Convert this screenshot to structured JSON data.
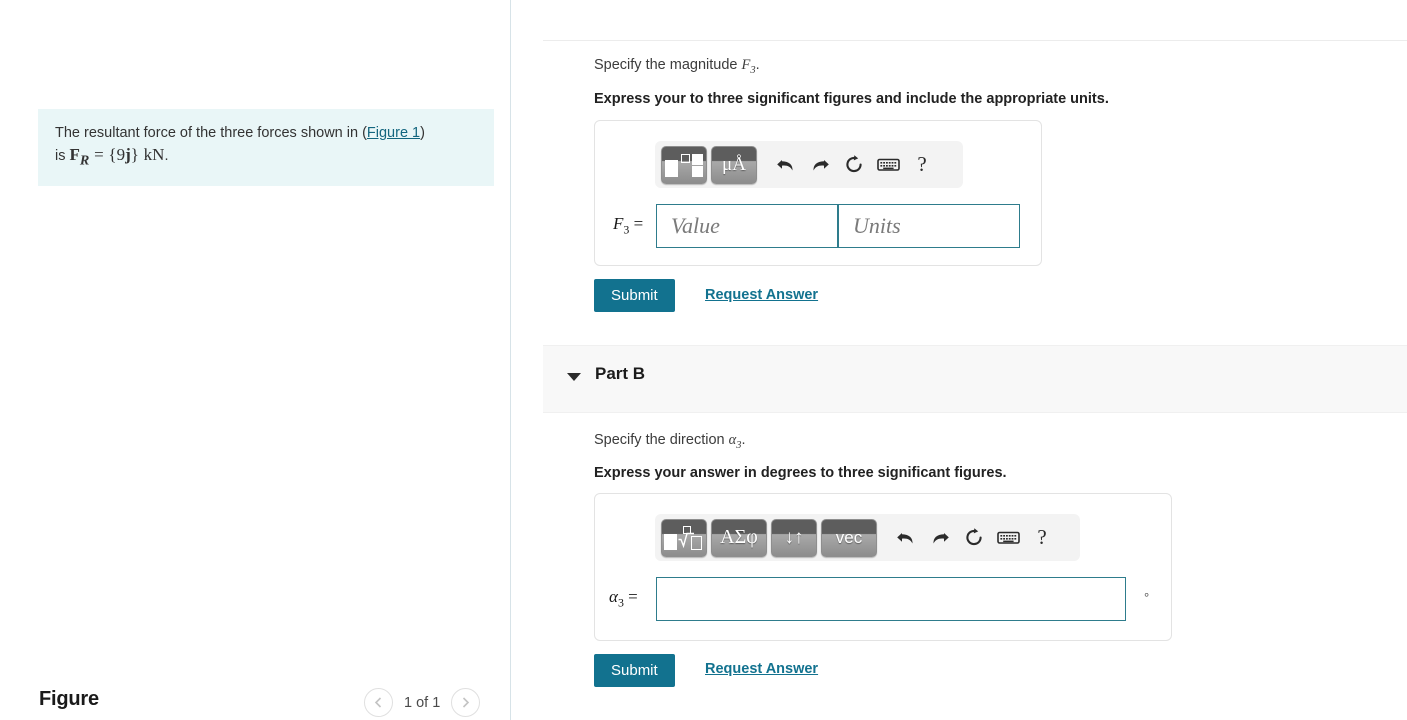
{
  "problem": {
    "text_before_link": "The resultant force of the three forces shown in (",
    "figure_link": "Figure 1",
    "text_after_link": ")",
    "line2_prefix": "is ",
    "formula": "F_R = {9j} kN",
    "formula_parts": {
      "symbol": "F",
      "subscript": "R",
      "equals": "=",
      "brace_open": "{",
      "magnitude": "9",
      "unit_vector": "j",
      "brace_close": "}",
      "units": "kN",
      "period": "."
    }
  },
  "figure_panel": {
    "title": "Figure",
    "pager_label": "1 of 1",
    "prev_icon": "chevron-left-icon",
    "next_icon": "chevron-right-icon"
  },
  "part_a": {
    "prompt_prefix": "Specify the magnitude ",
    "prompt_symbol": "F",
    "prompt_subscript": "3",
    "prompt_suffix": ".",
    "instruction": "Express your to three significant figures and include the appropriate units.",
    "field_symbol": "F",
    "field_subscript": "3",
    "field_equals": "=",
    "value_placeholder": "Value",
    "units_placeholder": "Units",
    "value_current": "",
    "units_current": "",
    "toolbar": [
      {
        "name": "math-template-button",
        "kind": "template",
        "label": ""
      },
      {
        "name": "units-button",
        "kind": "unit",
        "label": "μÅ"
      },
      {
        "name": "undo-button",
        "kind": "icon",
        "label": "undo-icon"
      },
      {
        "name": "redo-button",
        "kind": "icon",
        "label": "redo-icon"
      },
      {
        "name": "reset-button",
        "kind": "icon",
        "label": "reset-icon"
      },
      {
        "name": "keyboard-button",
        "kind": "icon",
        "label": "keyboard-icon"
      },
      {
        "name": "help-button",
        "kind": "help",
        "label": "?"
      }
    ],
    "submit_label": "Submit",
    "request_answer_label": "Request Answer"
  },
  "part_b": {
    "header_title": "Part B",
    "caret_icon": "chevron-down-icon",
    "prompt_prefix": "Specify the direction ",
    "prompt_symbol": "α",
    "prompt_subscript": "3",
    "prompt_suffix": ".",
    "instruction": "Express your answer in degrees to three significant figures.",
    "field_symbol": "α",
    "field_subscript": "3",
    "field_equals": "=",
    "answer_current": "",
    "answer_placeholder": "",
    "degree_symbol": "°",
    "toolbar": [
      {
        "name": "math-template-button",
        "kind": "template-radical",
        "label": ""
      },
      {
        "name": "greek-letters-button",
        "kind": "greek",
        "label": "ΑΣφ"
      },
      {
        "name": "arrows-button",
        "kind": "arrows",
        "label": "↓↑"
      },
      {
        "name": "vector-button",
        "kind": "vec",
        "label": "vec"
      },
      {
        "name": "undo-button",
        "kind": "icon",
        "label": "undo-icon"
      },
      {
        "name": "redo-button",
        "kind": "icon",
        "label": "redo-icon"
      },
      {
        "name": "reset-button",
        "kind": "icon",
        "label": "reset-icon"
      },
      {
        "name": "keyboard-button",
        "kind": "icon",
        "label": "keyboard-icon"
      },
      {
        "name": "help-button",
        "kind": "help",
        "label": "?"
      }
    ],
    "submit_label": "Submit",
    "request_answer_label": "Request Answer"
  },
  "colors": {
    "accent_teal": "#12728f",
    "statement_bg": "#e9f6f7",
    "input_border": "#2e7c8c",
    "band_bg": "#f8f8f8"
  }
}
